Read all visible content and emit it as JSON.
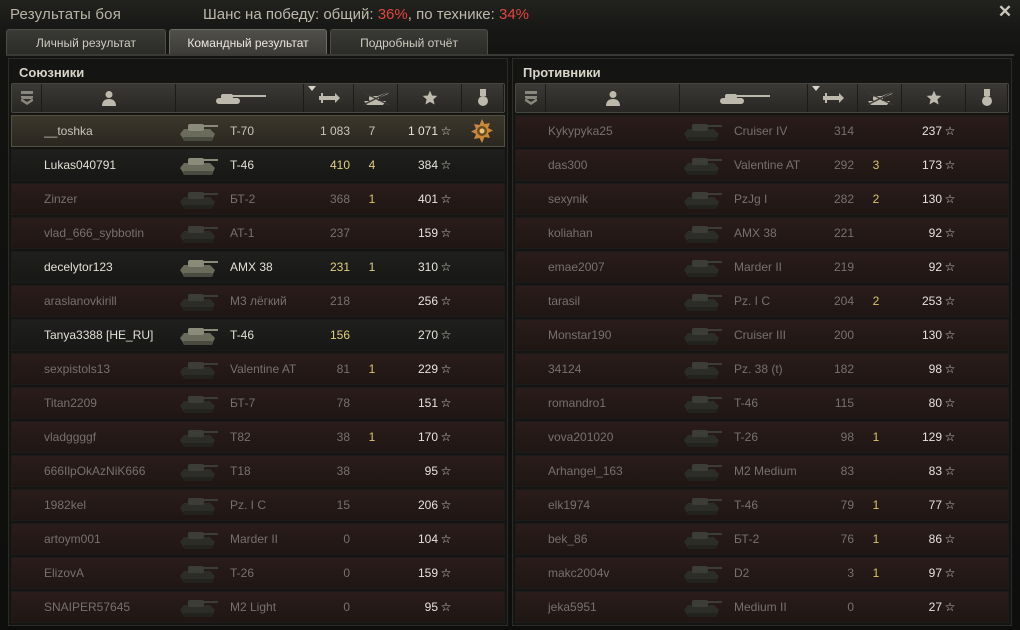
{
  "header": {
    "title": "Результаты боя",
    "chance_prefix": "Шанс на победу: общий: ",
    "chance_overall": "36%",
    "chance_mid": ", по технике: ",
    "chance_tech": "34%",
    "close_icon": "close-icon"
  },
  "tabs": [
    {
      "label": "Личный результат",
      "active": false
    },
    {
      "label": "Командный результат",
      "active": true
    },
    {
      "label": "Подробный отчёт",
      "active": false
    }
  ],
  "columns": {
    "icons": [
      "rank-icon",
      "player-icon",
      "tank-icon",
      "damage-icon",
      "kills-icon",
      "xp-star-icon",
      "medal-icon"
    ],
    "sorted_column": "damage"
  },
  "allies": {
    "title": "Союзники",
    "rows": [
      {
        "player": "__toshka",
        "tank": "T-70",
        "damage": "1 083",
        "kills": "7",
        "xp": "1 071",
        "state": "me",
        "medal": "medal-icon"
      },
      {
        "player": "Lukas040791",
        "tank": "T-46",
        "damage": "410",
        "kills": "4",
        "xp": "384",
        "state": "alive"
      },
      {
        "player": "Zinzer",
        "tank": "БТ-2",
        "damage": "368",
        "kills": "1",
        "xp": "401",
        "state": "dead"
      },
      {
        "player": "vlad_666_sybbotin",
        "tank": "AT-1",
        "damage": "237",
        "kills": "",
        "xp": "159",
        "state": "dead"
      },
      {
        "player": "decelytor123",
        "tank": "AMX 38",
        "damage": "231",
        "kills": "1",
        "xp": "310",
        "state": "alive"
      },
      {
        "player": "araslanovkirill",
        "tank": "М3 лёгкий",
        "damage": "218",
        "kills": "",
        "xp": "256",
        "state": "dead"
      },
      {
        "player": "Tanya3388 [HE_RU]",
        "tank": "T-46",
        "damage": "156",
        "kills": "",
        "xp": "270",
        "state": "alive"
      },
      {
        "player": "sexpistols13",
        "tank": "Valentine AT",
        "damage": "81",
        "kills": "1",
        "xp": "229",
        "state": "dead"
      },
      {
        "player": "Titan2209",
        "tank": "БТ-7",
        "damage": "78",
        "kills": "",
        "xp": "151",
        "state": "dead"
      },
      {
        "player": "vladggggf",
        "tank": "T82",
        "damage": "38",
        "kills": "1",
        "xp": "170",
        "state": "dead"
      },
      {
        "player": "666IlpOkAzNiK666",
        "tank": "T18",
        "damage": "38",
        "kills": "",
        "xp": "95",
        "state": "dead"
      },
      {
        "player": "1982kel",
        "tank": "Pz. I C",
        "damage": "15",
        "kills": "",
        "xp": "206",
        "state": "dead"
      },
      {
        "player": "artoym001",
        "tank": "Marder II",
        "damage": "0",
        "kills": "",
        "xp": "104",
        "state": "dead"
      },
      {
        "player": "ElizovA",
        "tank": "T-26",
        "damage": "0",
        "kills": "",
        "xp": "159",
        "state": "dead"
      },
      {
        "player": "SNAIPER57645",
        "tank": "M2 Light",
        "damage": "0",
        "kills": "",
        "xp": "95",
        "state": "dead"
      }
    ]
  },
  "enemies": {
    "title": "Противники",
    "rows": [
      {
        "player": "Kykypyka25",
        "tank": "Cruiser IV",
        "damage": "314",
        "kills": "",
        "xp": "237",
        "state": "dead"
      },
      {
        "player": "das300",
        "tank": "Valentine AT",
        "damage": "292",
        "kills": "3",
        "xp": "173",
        "state": "dead"
      },
      {
        "player": "sexynik",
        "tank": "PzJg I",
        "damage": "282",
        "kills": "2",
        "xp": "130",
        "state": "dead"
      },
      {
        "player": "koliahan",
        "tank": "AMX 38",
        "damage": "221",
        "kills": "",
        "xp": "92",
        "state": "dead"
      },
      {
        "player": "emae2007",
        "tank": "Marder II",
        "damage": "219",
        "kills": "",
        "xp": "92",
        "state": "dead"
      },
      {
        "player": "tarasil",
        "tank": "Pz. I C",
        "damage": "204",
        "kills": "2",
        "xp": "253",
        "state": "dead"
      },
      {
        "player": "Monstar190",
        "tank": "Cruiser III",
        "damage": "200",
        "kills": "",
        "xp": "130",
        "state": "dead"
      },
      {
        "player": "34124",
        "tank": "Pz. 38 (t)",
        "damage": "182",
        "kills": "",
        "xp": "98",
        "state": "dead"
      },
      {
        "player": "romandro1",
        "tank": "T-46",
        "damage": "115",
        "kills": "",
        "xp": "80",
        "state": "dead"
      },
      {
        "player": "vova201020",
        "tank": "T-26",
        "damage": "98",
        "kills": "1",
        "xp": "129",
        "state": "dead"
      },
      {
        "player": "Arhangel_163",
        "tank": "M2 Medium",
        "damage": "83",
        "kills": "",
        "xp": "83",
        "state": "dead"
      },
      {
        "player": "elk1974",
        "tank": "T-46",
        "damage": "79",
        "kills": "1",
        "xp": "77",
        "state": "dead"
      },
      {
        "player": "bek_86",
        "tank": "БТ-2",
        "damage": "76",
        "kills": "1",
        "xp": "86",
        "state": "dead"
      },
      {
        "player": "makc2004v",
        "tank": "D2",
        "damage": "3",
        "kills": "1",
        "xp": "97",
        "state": "dead"
      },
      {
        "player": "jeka5951",
        "tank": "Medium II",
        "damage": "0",
        "kills": "",
        "xp": "27",
        "state": "dead"
      }
    ]
  },
  "colors": {
    "accent_red": "#e2463e",
    "alive_value": "#e0cf7f",
    "dead_text": "#77716a"
  }
}
